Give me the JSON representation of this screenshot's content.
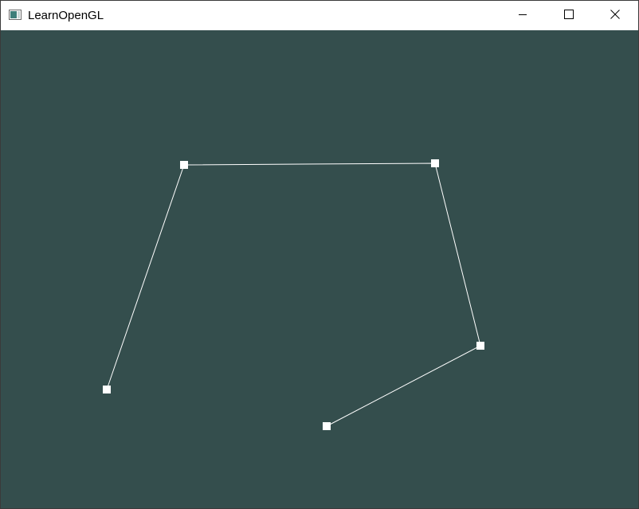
{
  "window": {
    "title": "LearnOpenGL",
    "app_icon": "opengl-app-icon",
    "controls": {
      "minimize_icon": "minimize-icon",
      "maximize_icon": "maximize-icon",
      "close_icon": "close-icon"
    }
  },
  "scene": {
    "clear_color": "#344E4D",
    "line_color": "#FFFFFF",
    "point_color": "#FFFFFF",
    "primitive": "line-strip-with-control-points"
  }
}
